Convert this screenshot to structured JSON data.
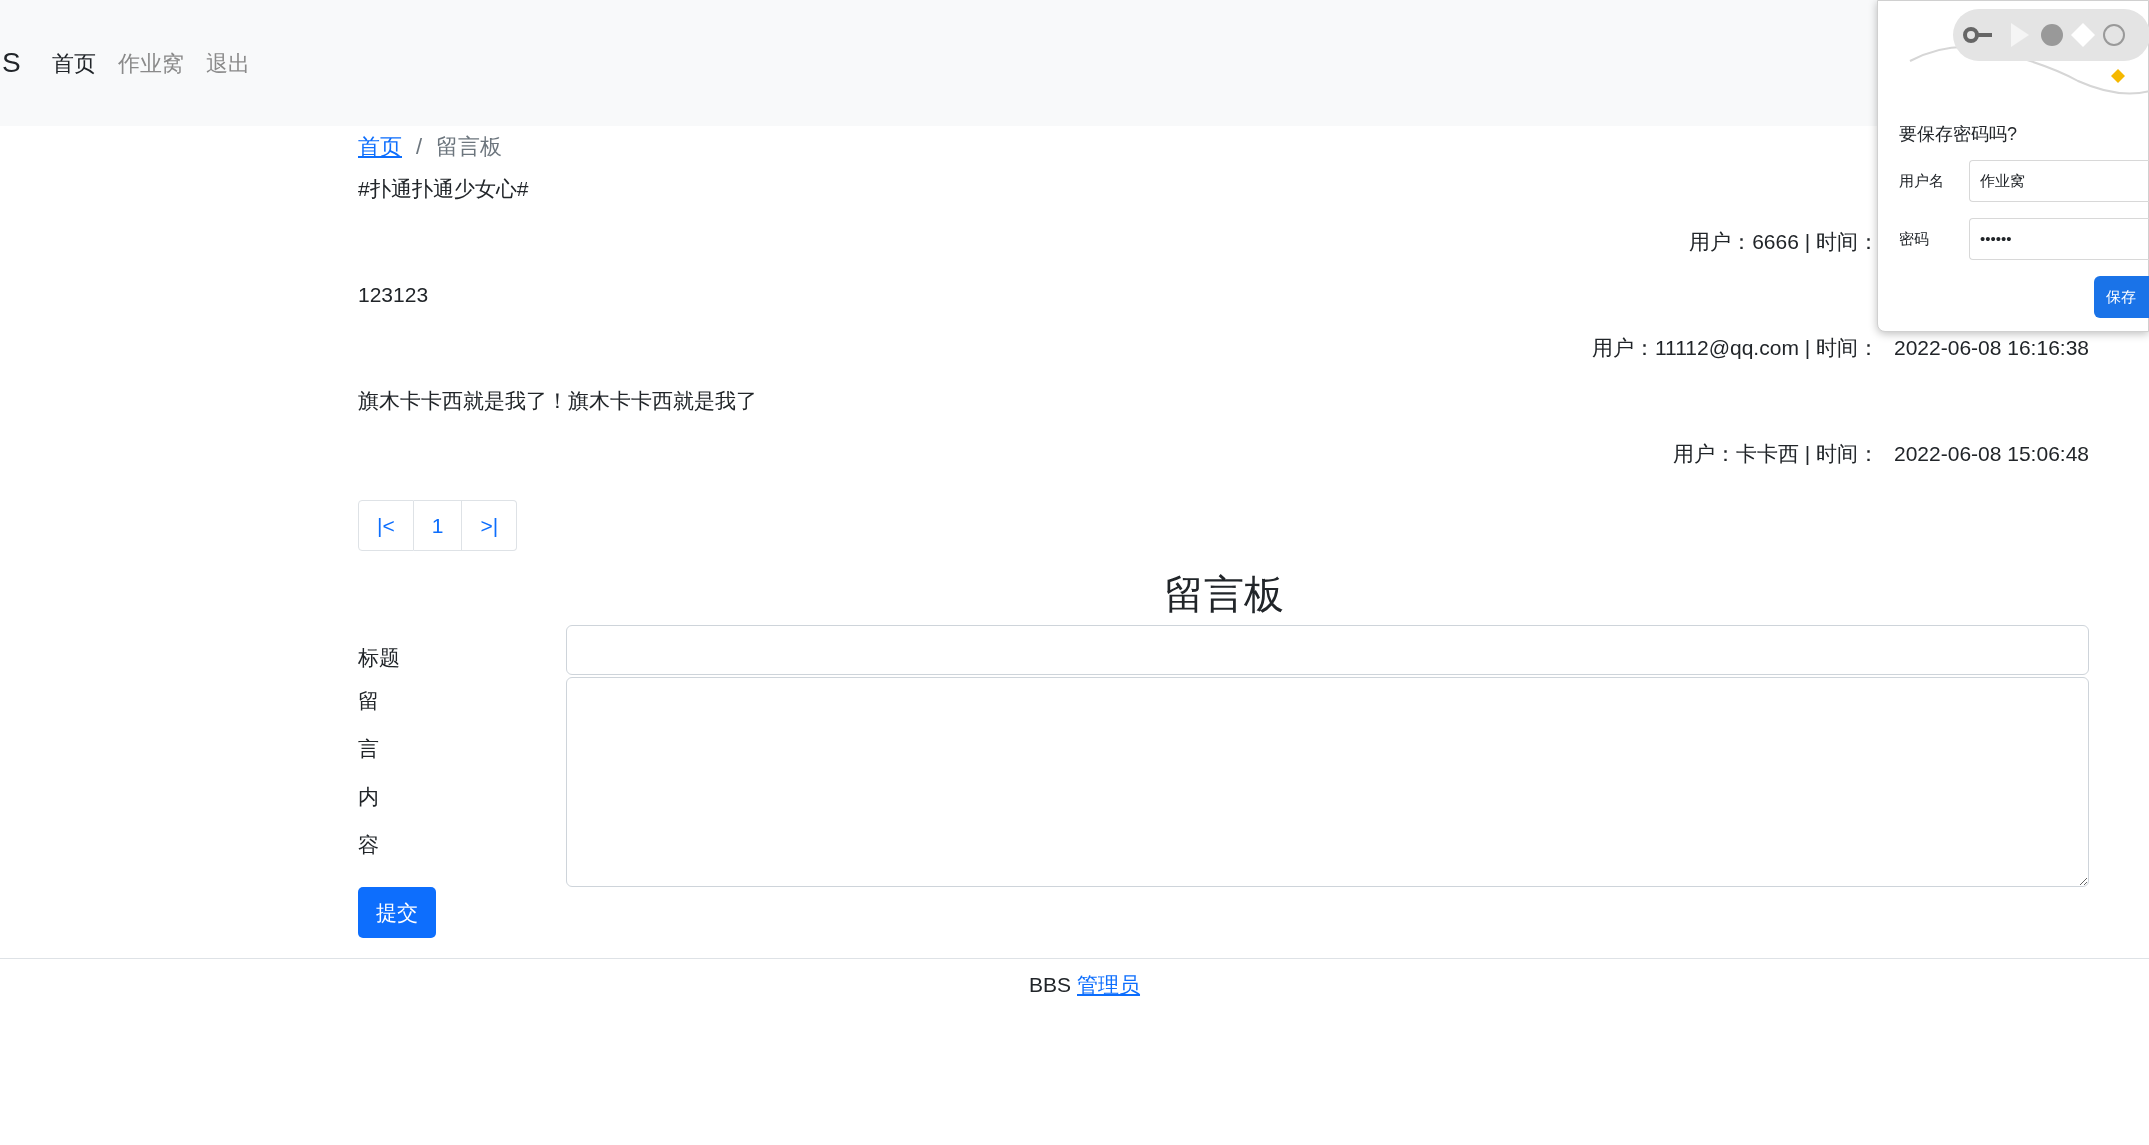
{
  "navbar": {
    "brand": "S",
    "links": [
      {
        "label": "首页",
        "selected": true
      },
      {
        "label": "作业窝",
        "selected": false
      },
      {
        "label": "退出",
        "selected": false
      }
    ]
  },
  "breadcrumb": {
    "link": "首页",
    "separator": "/",
    "current": "留言板"
  },
  "messages": [
    {
      "content": "#扑通扑通少女心#",
      "meta": "用户：6666 | 时间："
    },
    {
      "content": "123123",
      "meta": "用户：11112@qq.com | 时间：",
      "time": "2022-06-08 16:16:38"
    },
    {
      "content": "旗木卡卡西就是我了！旗木卡卡西就是我了",
      "meta": "用户：卡卡西 | 时间：",
      "time": "2022-06-08 15:06:48"
    }
  ],
  "pagination": [
    {
      "label": "|<"
    },
    {
      "label": "1"
    },
    {
      "label": ">|"
    }
  ],
  "form": {
    "heading": "留言板",
    "title_label": "标题",
    "content_label": [
      "留",
      "言",
      "内",
      "容"
    ],
    "submit": "提交"
  },
  "footer": {
    "text": "BBS",
    "link": "管理员"
  },
  "save_password_popup": {
    "title": "要保存密码吗?",
    "username_label": "用户名",
    "username": "作业窝",
    "password_label": "密码",
    "password": "••••••",
    "save_button": "保存"
  }
}
